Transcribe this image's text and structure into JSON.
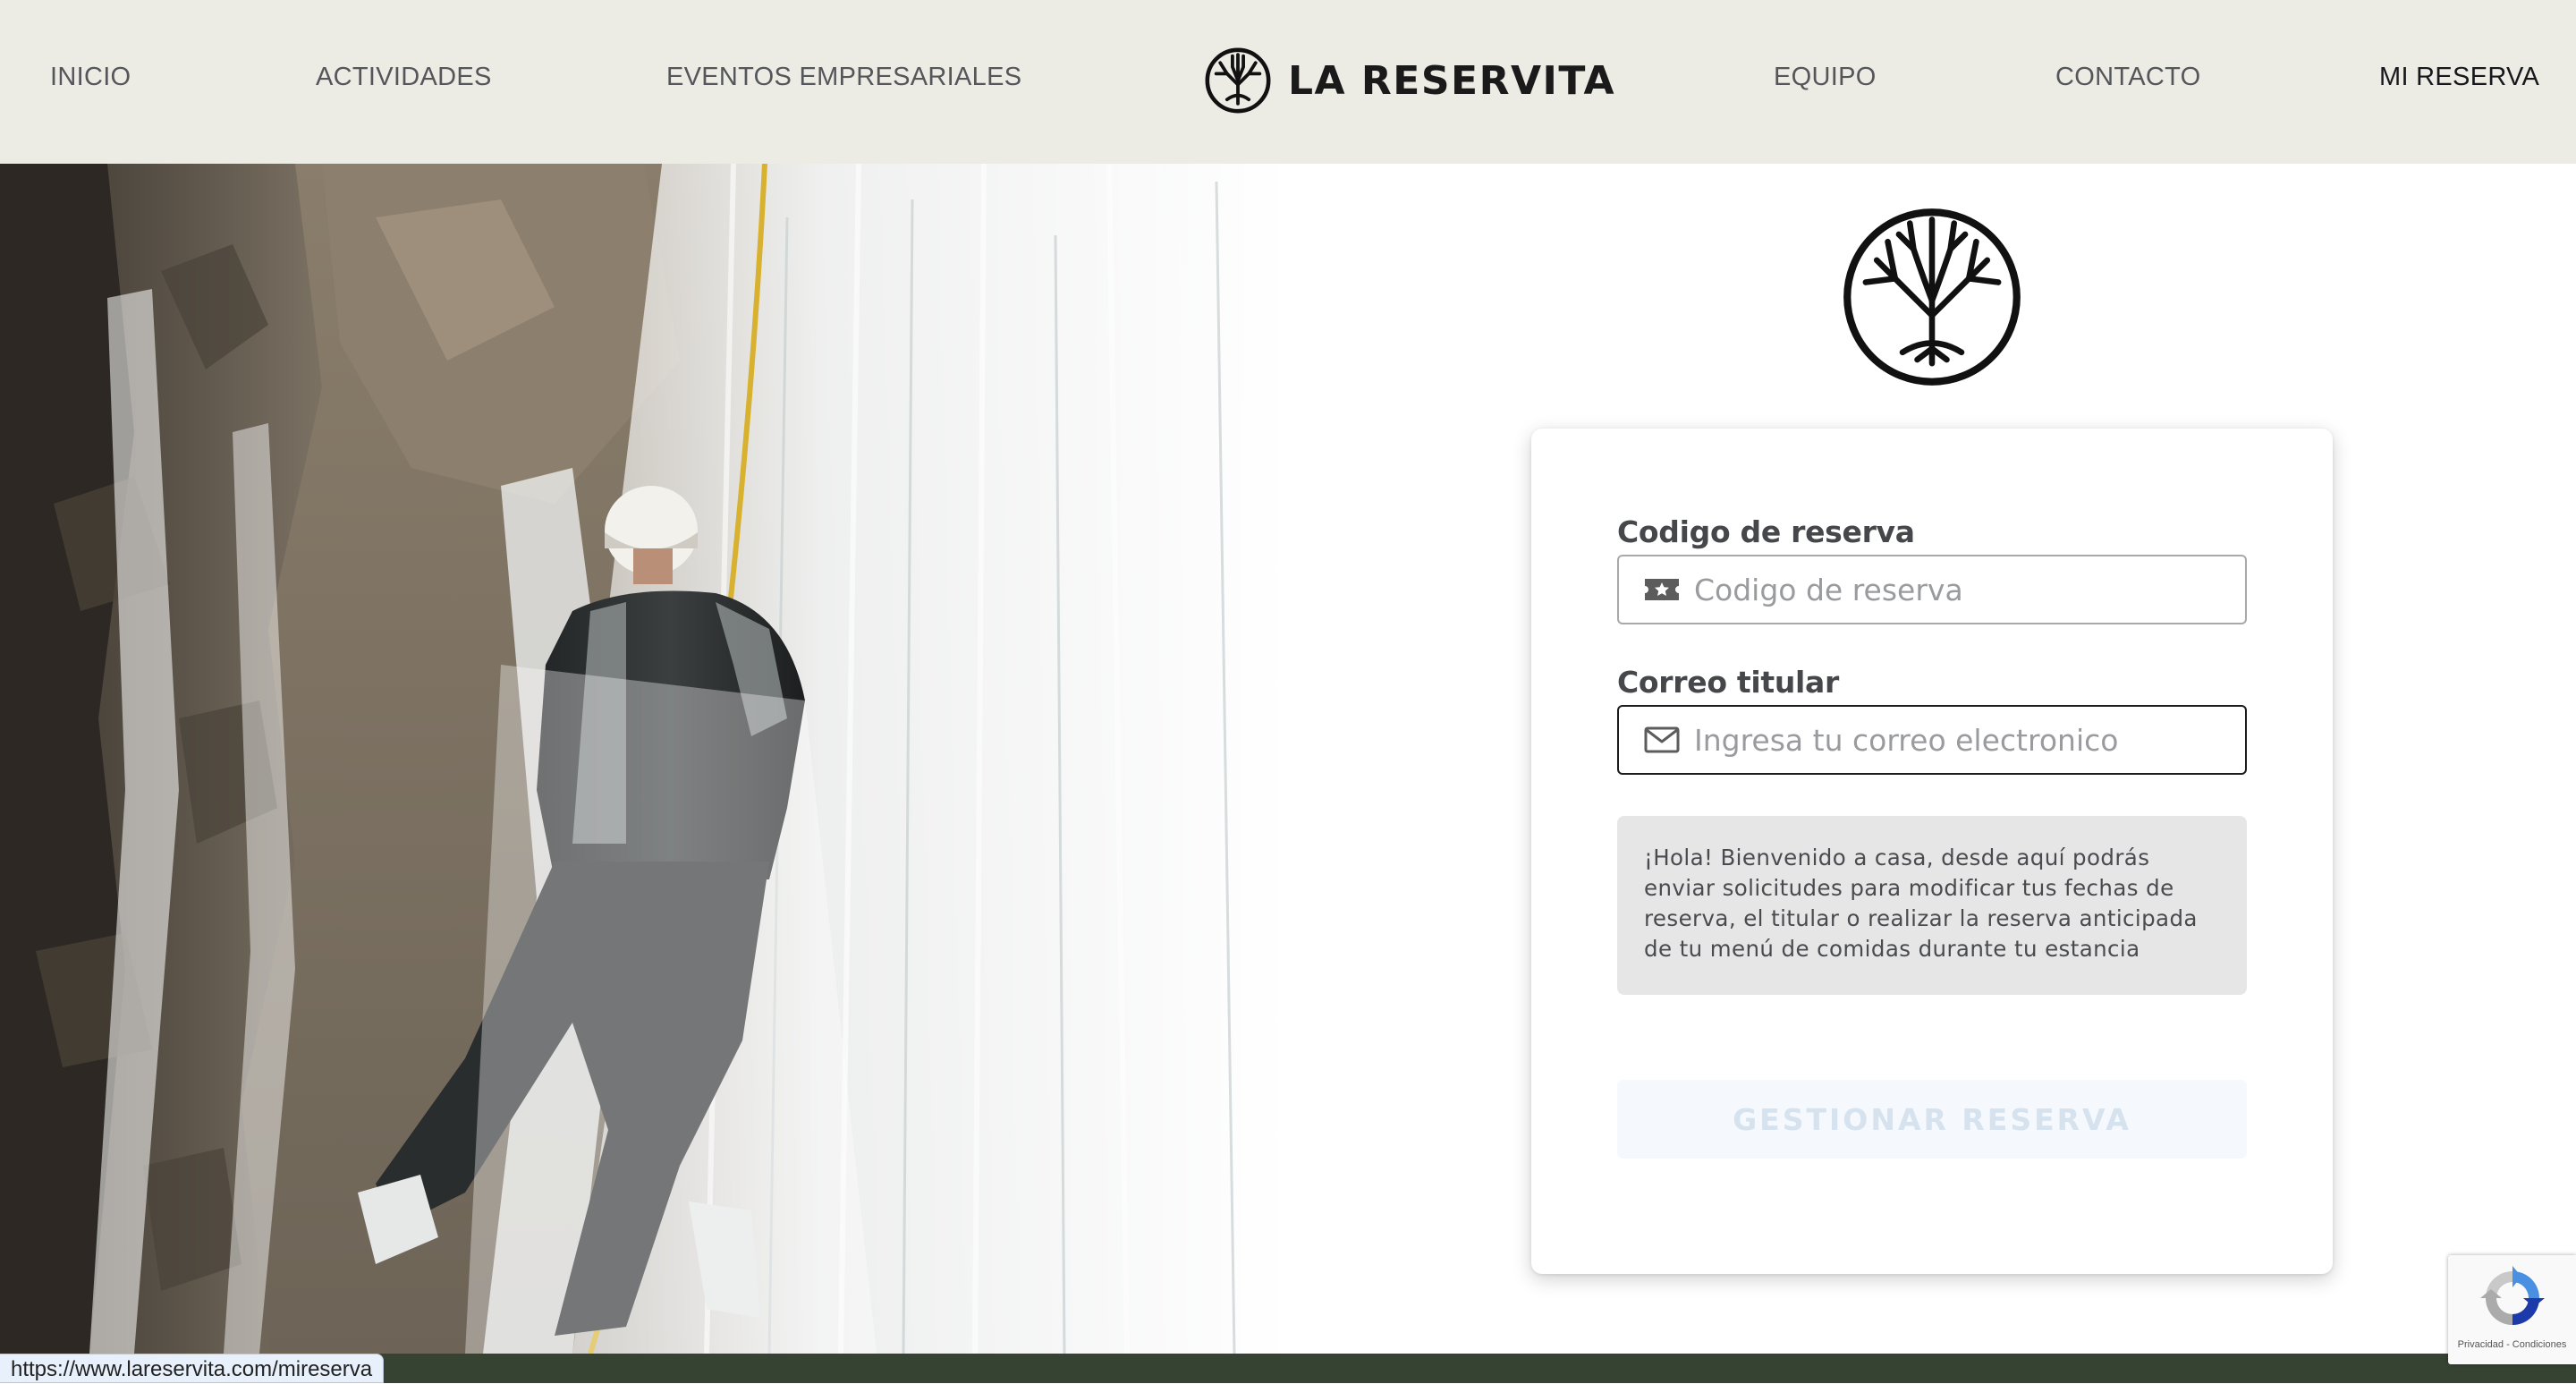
{
  "header": {
    "nav_left": [
      "INICIO",
      "ACTIVIDADES",
      "EVENTOS EMPRESARIALES"
    ],
    "brand": "LA RESERVITA",
    "nav_right": [
      "EQUIPO",
      "CONTACTO",
      "MI RESERVA"
    ],
    "active_item": "MI RESERVA",
    "logo_icon": "tree-logo-icon"
  },
  "hero": {
    "image": "canyoning-waterfall-photo"
  },
  "form": {
    "reservation_code": {
      "label": "Codigo de reserva",
      "placeholder": "Codigo de reserva",
      "value": "",
      "icon": "ticket-icon"
    },
    "email": {
      "label": "Correo titular",
      "placeholder": "Ingresa tu correo electronico",
      "value": "",
      "icon": "envelope-icon"
    },
    "info_text": "¡Hola! Bienvenido a casa, desde aquí podrás enviar solicitudes para modificar tus fechas de reserva, el titular o realizar la reserva anticipada de tu menú de comidas durante tu estancia",
    "submit_label": "GESTIONAR RESERVA"
  },
  "status_bar": {
    "url": "https://www.lareservita.com/mireserva"
  },
  "recaptcha": {
    "links": "Privacidad - Condiciones"
  },
  "colors": {
    "header_bg": "#ecebe4",
    "footer": "#364332",
    "info_bg": "#e6e6e6",
    "button_disabled_bg": "#f5f9fe",
    "button_disabled_text": "#d6e2ee"
  }
}
